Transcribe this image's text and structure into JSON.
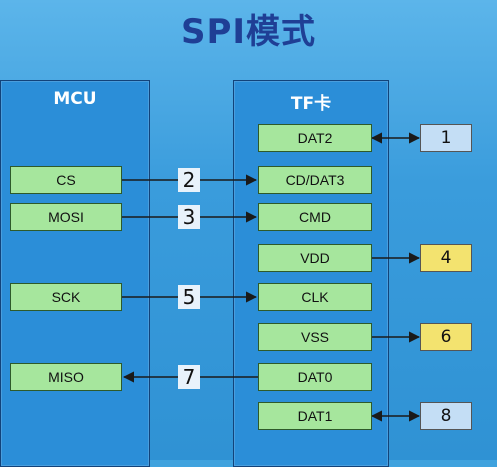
{
  "title": "SPI模式",
  "mcu": {
    "title": "MCU",
    "pins": [
      "CS",
      "MOSI",
      "SCK",
      "MISO"
    ]
  },
  "tf": {
    "title": "TF卡",
    "pins": [
      "DAT2",
      "CD/DAT3",
      "CMD",
      "VDD",
      "CLK",
      "VSS",
      "DAT0",
      "DAT1"
    ]
  },
  "wire_numbers": [
    "2",
    "3",
    "5",
    "7"
  ],
  "side_numbers": [
    "1",
    "4",
    "6",
    "8"
  ],
  "colors": {
    "pin_fill": "#a6e69d",
    "num_blue": "#c4def5",
    "num_yellow": "#f3e36f",
    "panel": "#2b8ed8",
    "title": "#1f3f95"
  }
}
